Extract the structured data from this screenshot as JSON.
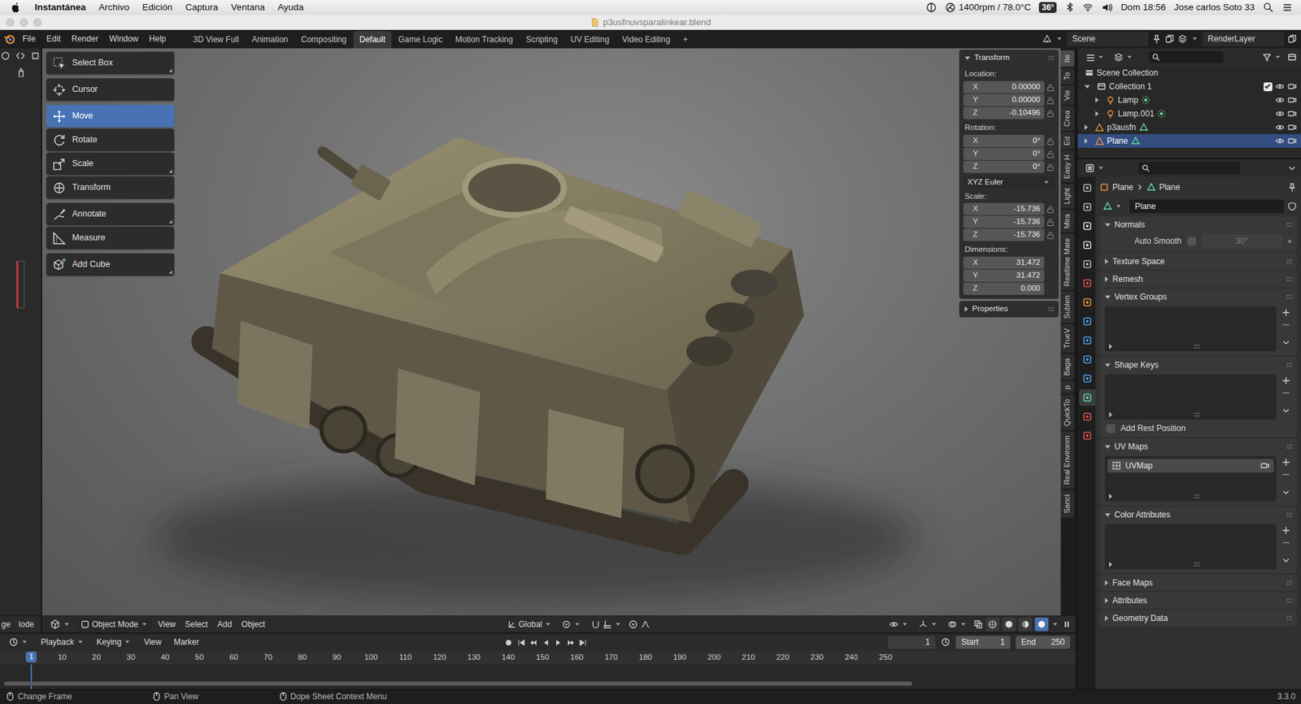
{
  "menubar": {
    "app": "Instantánea",
    "items": [
      "Archivo",
      "Edición",
      "Captura",
      "Ventana",
      "Ayuda"
    ],
    "fan": "1400rpm / 78.0°C",
    "temperature": "36°",
    "clock": "Dom 18:56",
    "user": "Jose carlos Soto 33"
  },
  "window": {
    "title": "p3usfnuvsparalinkear.blend"
  },
  "topbar": {
    "menus": [
      "File",
      "Edit",
      "Render",
      "Window",
      "Help"
    ],
    "workspaces": [
      {
        "label": "3D View Full",
        "selected": false
      },
      {
        "label": "Animation",
        "selected": false
      },
      {
        "label": "Compositing",
        "selected": false
      },
      {
        "label": "Default",
        "selected": true
      },
      {
        "label": "Game Logic",
        "selected": false
      },
      {
        "label": "Motion Tracking",
        "selected": false
      },
      {
        "label": "Scripting",
        "selected": false
      },
      {
        "label": "UV Editing",
        "selected": false
      },
      {
        "label": "Video Editing",
        "selected": false
      }
    ],
    "add_workspace": "+",
    "scene": "Scene",
    "view_layer": "RenderLayer"
  },
  "left_editor": {
    "header": [
      "ge",
      "lode"
    ]
  },
  "tool_groups": [
    [
      {
        "label": "Select Box",
        "selected": false,
        "more": true
      }
    ],
    [
      {
        "label": "Cursor",
        "selected": false,
        "more": false
      }
    ],
    [
      {
        "label": "Move",
        "selected": true,
        "more": false
      },
      {
        "label": "Rotate",
        "selected": false,
        "more": false
      },
      {
        "label": "Scale",
        "selected": false,
        "more": true
      },
      {
        "label": "Transform",
        "selected": false,
        "more": false
      }
    ],
    [
      {
        "label": "Annotate",
        "selected": false,
        "more": true
      },
      {
        "label": "Measure",
        "selected": false,
        "more": false
      }
    ],
    [
      {
        "label": "Add Cube",
        "selected": false,
        "more": true
      }
    ]
  ],
  "transform_panel": {
    "title": "Transform",
    "expanded": true,
    "location": {
      "label": "Location:",
      "fields": [
        {
          "axis": "X",
          "value": "0.00000"
        },
        {
          "axis": "Y",
          "value": "0.00000"
        },
        {
          "axis": "Z",
          "value": "-0.10496"
        }
      ]
    },
    "rotation": {
      "label": "Rotation:",
      "fields": [
        {
          "axis": "X",
          "value": "0°"
        },
        {
          "axis": "Y",
          "value": "0°"
        },
        {
          "axis": "Z",
          "value": "0°"
        }
      ]
    },
    "rotation_mode": "XYZ Euler",
    "scale": {
      "label": "Scale:",
      "fields": [
        {
          "axis": "X",
          "value": "-15.736"
        },
        {
          "axis": "Y",
          "value": "-15.736"
        },
        {
          "axis": "Z",
          "value": "-15.736"
        }
      ]
    },
    "dimensions": {
      "label": "Dimensions:",
      "fields": [
        {
          "axis": "X",
          "value": "31.472"
        },
        {
          "axis": "Y",
          "value": "31.472"
        },
        {
          "axis": "Z",
          "value": "0.000"
        }
      ]
    }
  },
  "properties_panel": {
    "title": "Properties",
    "expanded": false
  },
  "sidebar_tabs": [
    {
      "label": "Ite",
      "selected": true
    },
    {
      "label": "To",
      "selected": false
    },
    {
      "label": "Vie",
      "selected": false
    },
    {
      "label": "Crea",
      "selected": false
    },
    {
      "label": "Ed",
      "selected": false
    },
    {
      "label": "Easy H",
      "selected": false
    },
    {
      "label": "Light",
      "selected": false
    },
    {
      "label": "Mira",
      "selected": false
    },
    {
      "label": "Realtime Mate",
      "selected": false
    },
    {
      "label": "Sublen",
      "selected": false
    },
    {
      "label": "TrueV",
      "selected": false
    },
    {
      "label": "Baga",
      "selected": false
    },
    {
      "label": "p",
      "selected": false
    },
    {
      "label": "QuickTo",
      "selected": false
    },
    {
      "label": "Real Environm",
      "selected": false
    },
    {
      "label": "Sanct",
      "selected": false
    }
  ],
  "viewport_header": {
    "mode": "Object Mode",
    "menus": [
      "View",
      "Select",
      "Add",
      "Object"
    ],
    "orientation": "Global",
    "shading": [
      {
        "selected": false
      },
      {
        "selected": false
      },
      {
        "selected": false
      },
      {
        "selected": true
      }
    ]
  },
  "timeline": {
    "menus": [
      {
        "label": "Playback",
        "dropdown": true
      },
      {
        "label": "Keying",
        "dropdown": true
      },
      {
        "label": "View",
        "dropdown": false
      },
      {
        "label": "Marker",
        "dropdown": false
      }
    ],
    "current_frame": "1",
    "start_label": "Start",
    "start": "1",
    "end_label": "End",
    "end": "250",
    "ticks": [
      "10",
      "20",
      "30",
      "40",
      "50",
      "60",
      "70",
      "80",
      "90",
      "100",
      "110",
      "120",
      "130",
      "140",
      "150",
      "160",
      "170",
      "180",
      "190",
      "200",
      "210",
      "220",
      "230",
      "240",
      "250"
    ],
    "playhead": "1"
  },
  "outliner": {
    "tree": [
      {
        "name": "Scene Collection",
        "kind": "scene",
        "expanded": true,
        "selected": false,
        "children": [
          {
            "name": "Collection 1",
            "kind": "collection",
            "expanded": true,
            "selected": false,
            "checked": true,
            "children": [
              {
                "name": "Lamp",
                "kind": "light",
                "expanded": false,
                "selected": false
              },
              {
                "name": "Lamp.001",
                "kind": "light",
                "expanded": false,
                "selected": false
              }
            ]
          },
          {
            "name": "p3ausfn",
            "kind": "mesh",
            "expanded": false,
            "selected": false
          },
          {
            "name": "Plane",
            "kind": "mesh",
            "expanded": false,
            "selected": true
          }
        ]
      }
    ]
  },
  "properties": {
    "tabs": [
      {
        "color": "#b4b4b4",
        "selected": false
      },
      {
        "color": "#b4b4b4",
        "selected": false
      },
      {
        "color": "#d6d6d6",
        "selected": false
      },
      {
        "color": "#d6d6d6",
        "selected": false
      },
      {
        "color": "#b4b4b4",
        "selected": false
      },
      {
        "color": "#d9534f",
        "selected": false
      },
      {
        "color": "#e8913c",
        "selected": false
      },
      {
        "color": "#4f9ee3",
        "selected": false
      },
      {
        "color": "#4f9ee3",
        "selected": false
      },
      {
        "color": "#4f9ee3",
        "selected": false
      },
      {
        "color": "#4f9ee3",
        "selected": false
      },
      {
        "color": "#5fd39a",
        "selected": true
      },
      {
        "color": "#d9534f",
        "selected": false
      },
      {
        "color": "#d9534f",
        "selected": false
      }
    ],
    "breadcrumb": [
      "Plane",
      "Plane"
    ],
    "data_name": "Plane",
    "panels": [
      {
        "title": "Normals",
        "expanded": true,
        "kind": "normals",
        "label": "Auto Smooth",
        "checked": false,
        "angle": "30°",
        "angle_disabled": true
      },
      {
        "title": "Texture Space",
        "expanded": false,
        "kind": "collapsed"
      },
      {
        "title": "Remesh",
        "expanded": false,
        "kind": "collapsed"
      },
      {
        "title": "Vertex Groups",
        "expanded": true,
        "kind": "list",
        "items": []
      },
      {
        "title": "Shape Keys",
        "expanded": true,
        "kind": "list",
        "items": [],
        "option": {
          "label": "Add Rest Position",
          "checked": false
        }
      },
      {
        "title": "UV Maps",
        "expanded": true,
        "kind": "list",
        "items": [
          {
            "name": "UVMap",
            "selected": true
          }
        ]
      },
      {
        "title": "Color Attributes",
        "expanded": true,
        "kind": "list",
        "items": []
      },
      {
        "title": "Face Maps",
        "expanded": false,
        "kind": "collapsed"
      },
      {
        "title": "Attributes",
        "expanded": false,
        "kind": "collapsed"
      },
      {
        "title": "Geometry Data",
        "expanded": false,
        "kind": "collapsed"
      }
    ]
  },
  "statusbar": {
    "hints": [
      "Change Frame",
      "Pan View",
      "Dope Sheet Context Menu"
    ],
    "version": "3.3.0"
  }
}
